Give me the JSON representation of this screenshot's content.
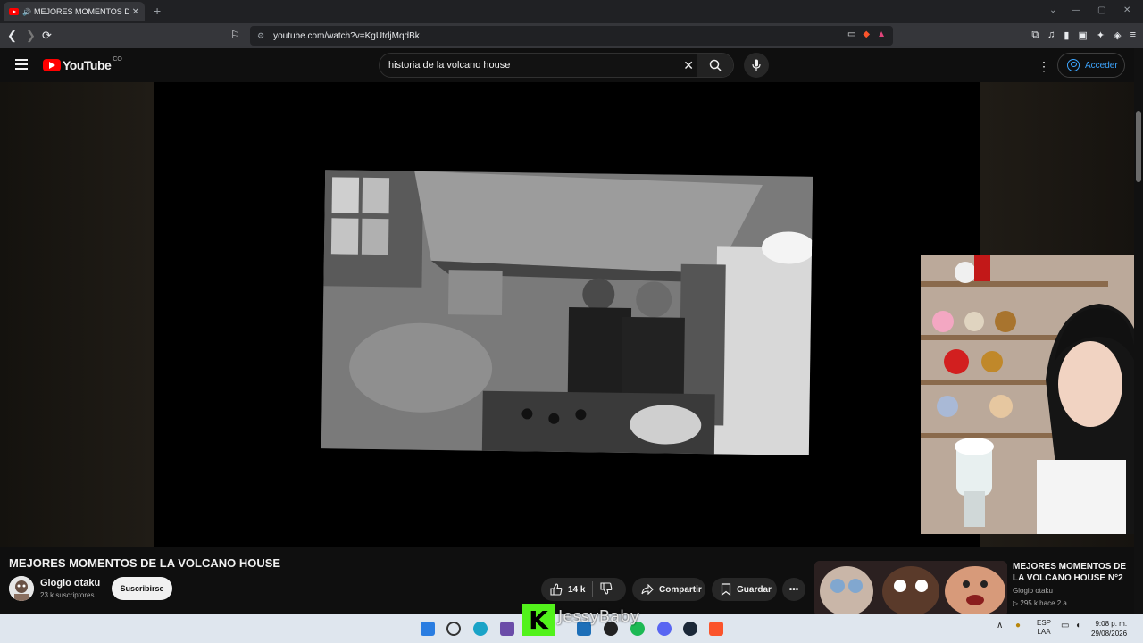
{
  "browser": {
    "tab_title": "MEJORES MOMENTOS DE LA",
    "url": "youtube.com/watch?v=KgUtdjMqdBk"
  },
  "youtube": {
    "logo_text": "YouTube",
    "country_code": "CO",
    "search_query": "historia de la volcano house",
    "sign_in_label": "Acceder"
  },
  "video": {
    "title": "MEJORES MOMENTOS DE LA VOLCANO HOUSE",
    "channel": "Glogio otaku",
    "subscribers": "23 k suscriptores",
    "subscribe_label": "Suscribirse",
    "likes": "14 k",
    "share_label": "Compartir",
    "save_label": "Guardar"
  },
  "recommendation": {
    "title": "MEJORES MOMENTOS DE LA VOLCANO HOUSE N°2",
    "channel": "Glogio otaku",
    "meta": "▷ 295 k   hace 2 a"
  },
  "overlay": {
    "kick_letter": "K",
    "streamer_name": "JessyBaby"
  },
  "taskbar": {
    "lang_top": "ESP",
    "lang_bottom": "LAA",
    "time": "9:08 p. m.",
    "date": "29/08/2026"
  },
  "colors": {
    "youtube_red": "#ff0000",
    "link_blue": "#3ea6ff",
    "kick_green": "#52f21b"
  }
}
